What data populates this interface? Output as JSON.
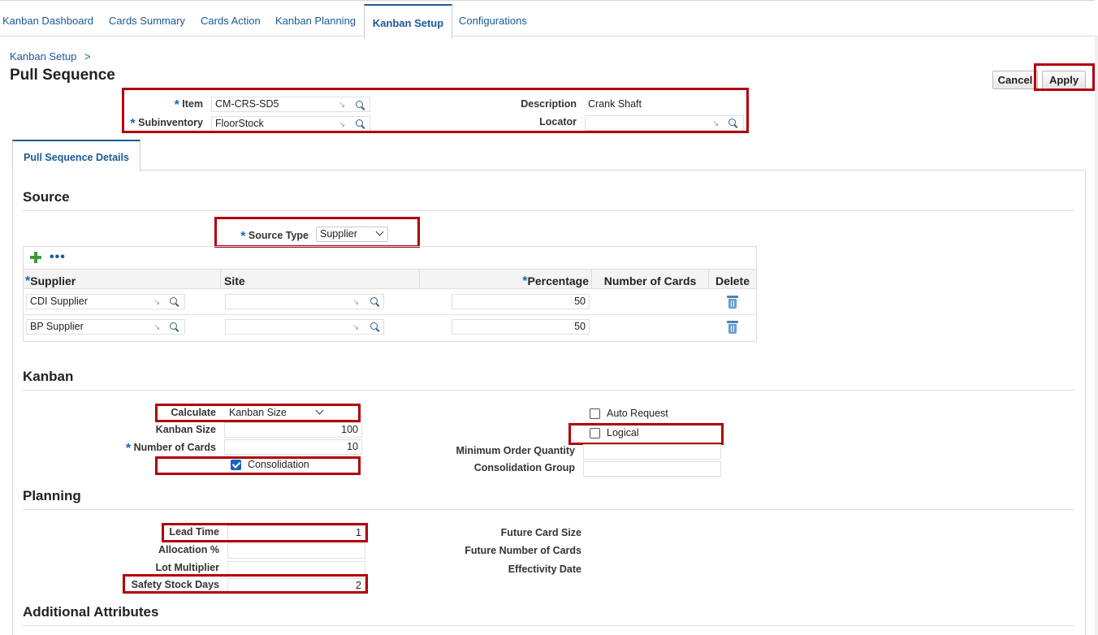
{
  "nav": {
    "tabs": [
      {
        "label": "Kanban Dashboard"
      },
      {
        "label": "Cards Summary"
      },
      {
        "label": "Cards Action"
      },
      {
        "label": "Kanban Planning"
      },
      {
        "label": "Kanban Setup"
      },
      {
        "label": "Configurations"
      }
    ],
    "active_tab": "Kanban Setup"
  },
  "breadcrumb": {
    "label": "Kanban Setup",
    "separator": ">"
  },
  "page": {
    "title": "Pull Sequence"
  },
  "actions": {
    "cancel_label": "Cancel",
    "apply_label": "Apply"
  },
  "header": {
    "item_label": "Item",
    "item_value": "CM-CRS-SD5",
    "subinventory_label": "Subinventory",
    "subinventory_value": "FloorStock",
    "description_label": "Description",
    "description_value": "Crank Shaft",
    "locator_label": "Locator",
    "locator_value": ""
  },
  "detail_tab": {
    "label": "Pull Sequence Details"
  },
  "source": {
    "heading": "Source",
    "source_type_label": "Source Type",
    "source_type_value": "Supplier",
    "more_glyph": "•••",
    "table": {
      "columns": [
        "Supplier",
        "Site",
        "Percentage",
        "Number of Cards",
        "Delete"
      ],
      "rows": [
        {
          "supplier": "CDI Supplier",
          "site": "",
          "percentage": "50",
          "cards": ""
        },
        {
          "supplier": "BP Supplier",
          "site": "",
          "percentage": "50",
          "cards": ""
        }
      ]
    }
  },
  "kanban": {
    "heading": "Kanban",
    "calculate_label": "Calculate",
    "calculate_value": "Kanban Size",
    "kanban_size_label": "Kanban Size",
    "kanban_size_value": "100",
    "num_cards_label": "Number of Cards",
    "num_cards_value": "10",
    "consolidation_label": "Consolidation",
    "consolidation_checked": true,
    "auto_request_label": "Auto Request",
    "auto_request_checked": false,
    "logical_label": "Logical",
    "logical_checked": false,
    "min_order_label": "Minimum Order Quantity",
    "min_order_value": "",
    "consolidation_group_label": "Consolidation Group",
    "consolidation_group_value": ""
  },
  "planning": {
    "heading": "Planning",
    "lead_time_label": "Lead Time",
    "lead_time_value": "1",
    "allocation_label": "Allocation %",
    "allocation_value": "",
    "lot_multiplier_label": "Lot Multiplier",
    "lot_multiplier_value": "",
    "safety_stock_label": "Safety Stock Days",
    "safety_stock_value": "2",
    "future_card_size_label": "Future Card Size",
    "future_num_cards_label": "Future Number of Cards",
    "effectivity_label": "Effectivity Date"
  },
  "additional": {
    "heading": "Additional Attributes"
  },
  "colors": {
    "link": "#1a5a96",
    "required": "#1565c0",
    "highlight": "#b0000b",
    "add": "#3d9b35"
  }
}
